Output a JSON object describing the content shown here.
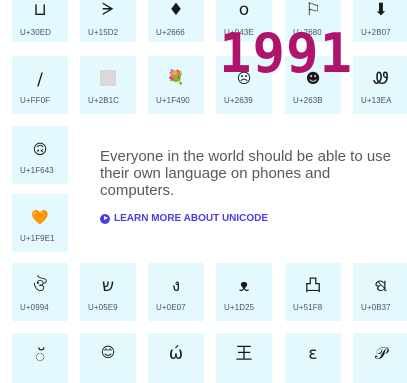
{
  "year": "1991",
  "intro": "Everyone in the world should be able to use their own language on phones and computers.",
  "learn_more": "LEARN MORE ABOUT UNICODE",
  "tiles": [
    {
      "glyph": "⊔",
      "code": "U+30ED"
    },
    {
      "glyph": "ᗒ",
      "code": "U+15D2"
    },
    {
      "glyph": "♦",
      "code": "U+2666"
    },
    {
      "glyph": "о",
      "code": "U+043E"
    },
    {
      "glyph": "⚐",
      "code": "U+2680"
    },
    {
      "glyph": "⬇",
      "code": "U+2B07"
    },
    {
      "glyph": "/",
      "code": "U+FF0F"
    },
    {
      "glyph": "",
      "code": "U+2B1C"
    },
    {
      "glyph": "💐",
      "code": "U+1F490"
    },
    {
      "glyph": "☹",
      "code": "U+2639"
    },
    {
      "glyph": "☻",
      "code": "U+263B"
    },
    {
      "glyph": "Ꮺ",
      "code": "U+13EA"
    },
    {
      "glyph": "🙃",
      "code": "U+1F643"
    },
    {
      "glyph": "🧡",
      "code": "U+1F9E1"
    },
    {
      "glyph": "ঔ",
      "code": "U+0994"
    },
    {
      "glyph": "ש",
      "code": "U+05E9"
    },
    {
      "glyph": "ง",
      "code": "U+0E07"
    },
    {
      "glyph": "ᴥ",
      "code": "U+1D25"
    },
    {
      "glyph": "凸",
      "code": "U+51F8"
    },
    {
      "glyph": "ଷ",
      "code": "U+0B37"
    },
    {
      "glyph": "ॅ",
      "code": ""
    },
    {
      "glyph": "😊",
      "code": ""
    },
    {
      "glyph": "ώ",
      "code": ""
    },
    {
      "glyph": "王",
      "code": ""
    },
    {
      "glyph": "ε",
      "code": ""
    },
    {
      "glyph": "𝒫",
      "code": ""
    }
  ],
  "colors": {
    "tile_bg": "#e4f9fd",
    "year": "#b0136b",
    "link": "#4a3fe0",
    "intro_text": "#555a5e"
  }
}
